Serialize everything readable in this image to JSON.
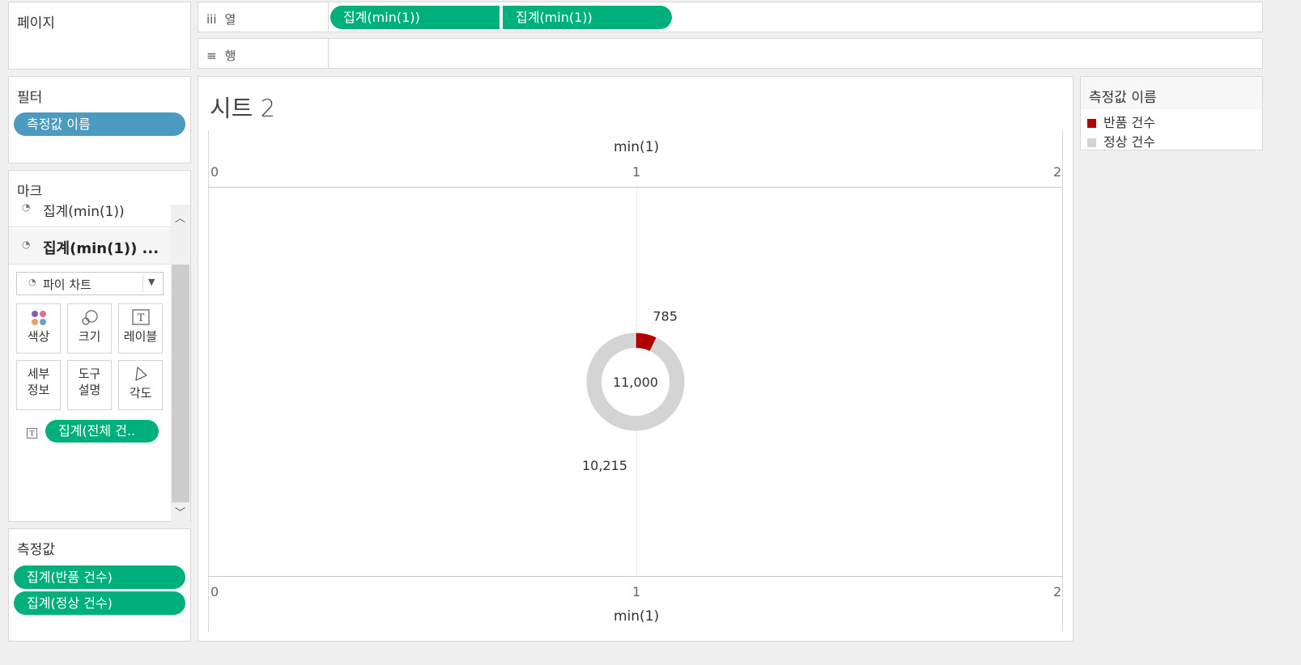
{
  "pages_panel": {
    "title": "페이지"
  },
  "columns_shelf": {
    "icon": "iii",
    "label": "열",
    "pills": [
      "집계(min(1))",
      "집계(min(1))"
    ]
  },
  "rows_shelf": {
    "icon": "≡",
    "label": "행"
  },
  "filters_panel": {
    "title": "필터",
    "pills": [
      "측정값 이름"
    ]
  },
  "marks_panel": {
    "title": "마크",
    "layers": [
      "집계(min(1))",
      "집계(min(1)) ..."
    ],
    "mark_type": "파이 차트",
    "buttons": {
      "color": "색상",
      "size": "크기",
      "label": "레이블",
      "detail_1": "세부",
      "detail_2": "정보",
      "tooltip_1": "도구",
      "tooltip_2": "설명",
      "angle": "각도"
    },
    "label_pill": "집계(전체 건.."
  },
  "measure_values_panel": {
    "title": "측정값",
    "pills": [
      "집계(반품 건수)",
      "집계(정상 건수)"
    ]
  },
  "sheet": {
    "title": "시트 2",
    "axis_title": "min(1)",
    "axis_ticks": [
      "0",
      "1",
      "2"
    ]
  },
  "legend": {
    "title": "측정값 이름",
    "items": [
      {
        "label": "반품 건수",
        "color": "#b00000"
      },
      {
        "label": "정상 건수",
        "color": "#d4d4d4"
      }
    ]
  },
  "chart_data": {
    "type": "pie",
    "categories": [
      "반품 건수",
      "정상 건수"
    ],
    "values": [
      785,
      10215
    ],
    "center_label": "11,000",
    "slice_labels": [
      "785",
      "10,215"
    ],
    "colors": [
      "#b00000",
      "#d4d4d4"
    ],
    "axis_range": [
      0,
      2
    ],
    "x_value": 1
  }
}
